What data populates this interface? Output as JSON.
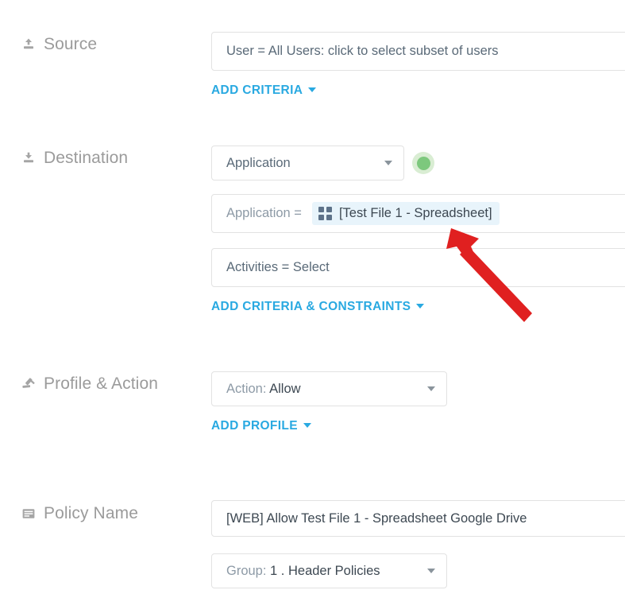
{
  "colors": {
    "link": "#29a9e1",
    "label": "#9b9b9b",
    "field_text": "#5a6a78",
    "chip_bg": "#e8f4fb",
    "chip_icon": "#5d7289",
    "status_green": "#7dc87d",
    "annotation_red": "#e02020",
    "border": "#e2e2e2"
  },
  "source": {
    "label": "Source",
    "icon": "upload-icon",
    "criteria_value": "User = All Users: click to select subset of users",
    "add_link": "ADD CRITERIA"
  },
  "destination": {
    "label": "Destination",
    "icon": "download-icon",
    "type_select": "Application",
    "status_indicator": "green-status-dot",
    "application_row": {
      "prefix": "Application =",
      "chip_icon": "app-grid-icon",
      "chip_label": "[Test File 1 - Spreadsheet]"
    },
    "activities_row": "Activities = Select",
    "add_link": "ADD CRITERIA & CONSTRAINTS"
  },
  "profile_action": {
    "label": "Profile & Action",
    "icon": "gavel-icon",
    "action_prefix": "Action:",
    "action_value": "Allow",
    "add_link": "ADD PROFILE"
  },
  "policy_name": {
    "label": "Policy Name",
    "icon": "document-lines-icon",
    "name_value": "[WEB] Allow Test File 1 - Spreadsheet Google Drive",
    "group_prefix": "Group:",
    "group_value": "1 . Header Policies"
  },
  "annotation": {
    "type": "red-arrow",
    "points_to": "[Test File 1 - Spreadsheet]"
  }
}
